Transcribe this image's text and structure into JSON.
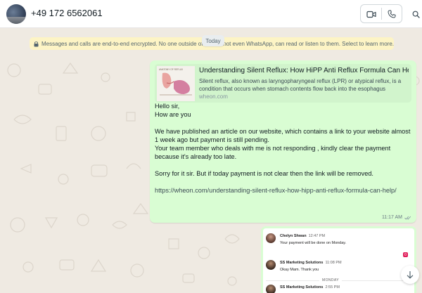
{
  "header": {
    "contact_name": "+49 172 6562061",
    "icons": [
      "video-call-icon",
      "voice-call-icon",
      "search-icon"
    ]
  },
  "notice": {
    "left_text": "Messages and calls are end-to-end encrypted. No one outside of",
    "right_text": "not even WhatsApp, can read or listen to them. Select to learn more.",
    "icon": "lock-icon"
  },
  "date_chip": "Today",
  "message": {
    "link_preview": {
      "title": "Understanding Silent Reflux: How HiPP Anti Reflux Formula Can Hel...",
      "description": "Silent reflux, also known as laryngopharyngeal reflux (LPR) or atypical reflux, is a condition that occurs when stomach contents flow back into the esophagus",
      "domain": "wheon.com",
      "thumbnail_caption": "ANATOMY OF REFLUX"
    },
    "lines": {
      "l1": "Hello sir,",
      "l2": "How are you",
      "l3": "We have published an article on our website, which contains a link to your website almost 1 week ago but payment is still pending.",
      "l4": "Your team member who deals with me is not responding , kindly clear the payment because it's already too late.",
      "l5": "Sorry for it sir. But if today payment is not clear then the link will be removed.",
      "l6": "https://wheon.com/understanding-silent-reflux-how-hipp-anti-reflux-formula-can-help/"
    },
    "time": "11:17 AM",
    "status_icon": "double-check-icon"
  },
  "screenshot_message": {
    "rows": [
      {
        "name": "Chelyn Shwan",
        "time": "12:47 PM",
        "text": "Your payment will be done on Monday."
      },
      {
        "name": "SS Marketing Solutions",
        "time": "11:08 PM",
        "text": "Okay Mam. Thank you"
      },
      {
        "name": "SS Marketing Solutions",
        "time": "2:55 PM",
        "text": ""
      }
    ],
    "day_divider": "MONDAY",
    "badge": "0"
  },
  "colors": {
    "outgoing_bubble": "#d9fdd3",
    "notice_bg": "#fdf4c5",
    "wallpaper": "#efeae2",
    "read_ticks": "#8696a0"
  }
}
